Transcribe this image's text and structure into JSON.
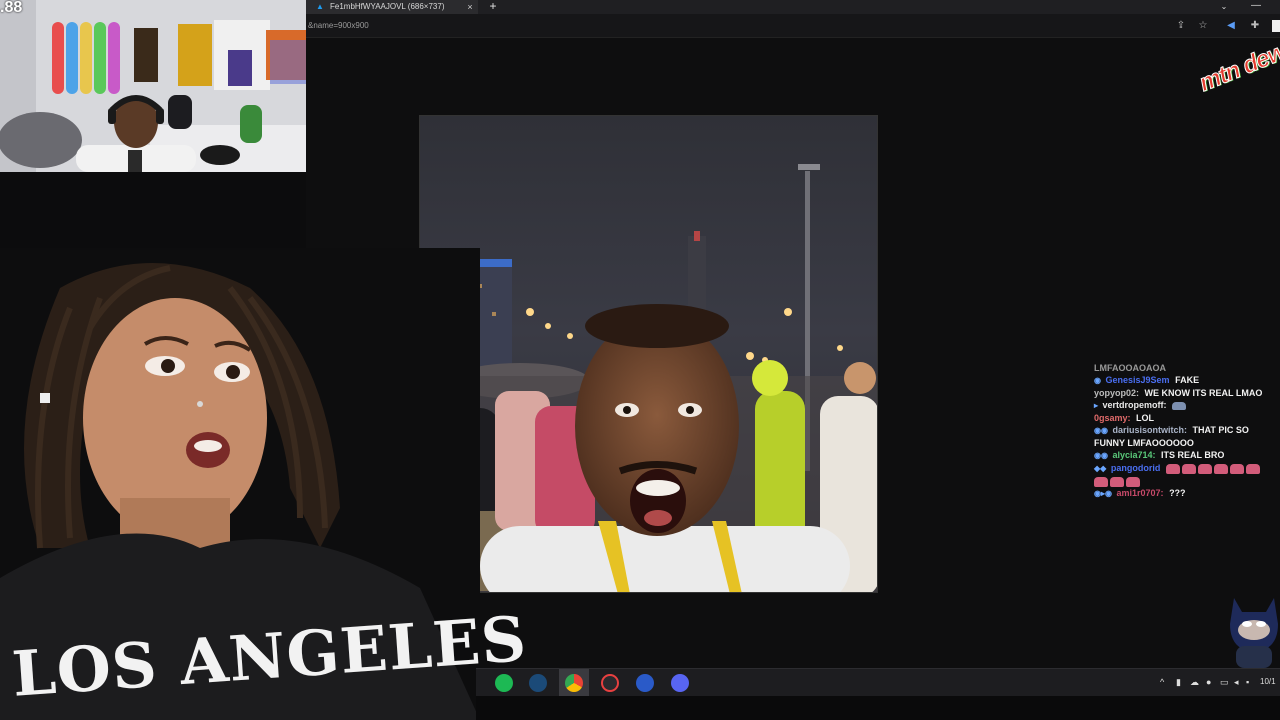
{
  "streamer_cam": {
    "counter": ".88"
  },
  "browser": {
    "tab_title": "Fe1mbHfWYAAJOVL (686×737)",
    "tab_close": "×",
    "new_tab": "+",
    "url": "&name=900x900",
    "tab_overflow": "⌄",
    "window_minimize": "—"
  },
  "brand": {
    "text": "mtn dew"
  },
  "reactor": {
    "shirt_text": "LOS ANGELES"
  },
  "chat": {
    "messages": [
      {
        "user": "",
        "text": "LMFAOOAOAOA"
      },
      {
        "user": "GenesisJ9Sem",
        "text": "FAKE"
      },
      {
        "user": "yopyop02:",
        "text": "WE KNOW ITS REAL LMAO"
      },
      {
        "user": "vertdropemoff:",
        "text": ""
      },
      {
        "user": "0gsamy:",
        "text": "LOL"
      },
      {
        "user": "dariusisontwitch:",
        "text": "THAT PIC SO FUNNY LMFAOOOOOO"
      },
      {
        "user": "alycia714:",
        "text": "ITS REAL BRO"
      },
      {
        "user": "pangodorid",
        "text": ""
      },
      {
        "user": "ami1r0707:",
        "text": "???"
      }
    ]
  },
  "taskbar": {
    "apps": [
      "spotify-icon",
      "steam-icon",
      "chrome-icon",
      "obs-icon",
      "refresh-app-icon",
      "discord-icon"
    ],
    "tray_chevron": "^",
    "date": "10/1"
  },
  "colors": {
    "twitter_blue": "#1d9bf0",
    "spotify_green": "#1db954",
    "discord_blurple": "#5865f2",
    "mtn_dew_red": "#e33b2d"
  }
}
